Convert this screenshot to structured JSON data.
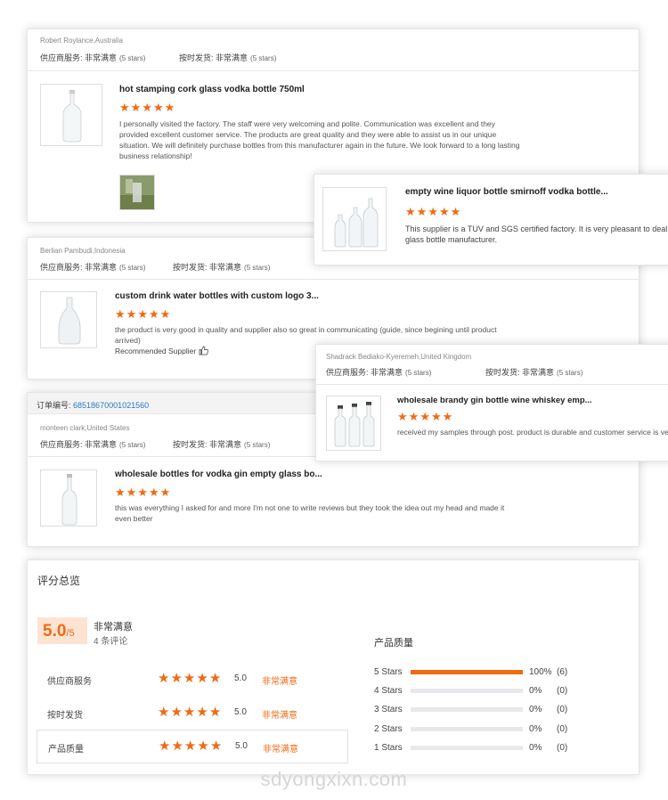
{
  "reviews": [
    {
      "reviewer": "Robert Roylance,Australia",
      "service_label": "供应商服务:",
      "service_value": "非常满意",
      "service_stars": "(5 stars)",
      "shipping_label": "按时发货:",
      "shipping_value": "非常满意",
      "shipping_stars": "(5 stars)",
      "product_title": "hot stamping cork glass vodka bottle 750ml",
      "rating": 5,
      "text": "I personally visited the factory.   The staff were very welcoming and polite.  Communication  was  excellent and they provided excellent customer service. The products are great quality and they were able to assist us in our unique situation. We will definitely purchase bottles from this manufacturer again in the future. We look forward to a long lasting business relationship!"
    },
    {
      "product_title": "empty wine liquor bottle smirnoff vodka bottle...",
      "rating": 5,
      "text": "This supplier is a TUV and SGS certified factory. It is very pleasant to deal glass bottle manufacturer."
    },
    {
      "reviewer": "Berlian Pambudi,Indonesia",
      "service_label": "供应商服务:",
      "service_value": "非常满意",
      "service_stars": "(5 stars)",
      "shipping_label": "按时发货:",
      "shipping_value": "非常满意",
      "shipping_stars": "(5 stars)",
      "product_title": "custom drink water bottles with custom logo 3...",
      "rating": 5,
      "text": "the product is very good in quality and supplier also so great in communicating (guide, since begining until product arrived)",
      "recommended": "Recommended Supplier"
    },
    {
      "reviewer": "Shadrack Bediako-Kyeremeh,United Kingdom",
      "service_label": "供应商服务:",
      "service_value": "非常满意",
      "service_stars": "(5 stars)",
      "shipping_label": "按时发货:",
      "shipping_value": "非常满意",
      "shipping_stars": "(5 stars)",
      "product_title": "wholesale brandy gin bottle wine whiskey emp...",
      "rating": 5,
      "text": "received my samples through post. product is durable and customer service is ve"
    },
    {
      "order_label": "订单编号:",
      "order_number": "68518670001021560",
      "reviewer": "monteen clark,United States",
      "service_label": "供应商服务:",
      "service_value": "非常满意",
      "service_stars": "(5 stars)",
      "shipping_label": "按时发货:",
      "shipping_value": "非常满意",
      "shipping_stars": "(5 stars)",
      "product_title": "wholesale bottles for vodka gin empty glass bo...",
      "rating": 5,
      "text": "this was everything I asked for and more I'm not one to write reviews but they took the idea out my head and made it even better"
    }
  ],
  "summary": {
    "title": "评分总览",
    "score": "5.0",
    "out_of": "/5",
    "satisfaction": "非常满意",
    "review_count": "4 条评论",
    "rows": [
      {
        "label": "供应商服务",
        "value": "5.0",
        "text": "非常满意"
      },
      {
        "label": "按时发货",
        "value": "5.0",
        "text": "非常满意"
      },
      {
        "label": "产品质量",
        "value": "5.0",
        "text": "非常满意"
      }
    ],
    "quality_title": "产品质量",
    "distribution": [
      {
        "label": "5 Stars",
        "fraction": 1.0,
        "pct": "100%",
        "count": "(6)"
      },
      {
        "label": "4 Stars",
        "fraction": 0,
        "pct": "0%",
        "count": "(0)"
      },
      {
        "label": "3 Stars",
        "fraction": 0,
        "pct": "0%",
        "count": "(0)"
      },
      {
        "label": "2 Stars",
        "fraction": 0,
        "pct": "0%",
        "count": "(0)"
      },
      {
        "label": "1 Stars",
        "fraction": 0,
        "pct": "0%",
        "count": "(0)"
      }
    ]
  },
  "watermark": "sdyongxixn.com",
  "colors": {
    "accent": "#f06a12",
    "link": "#2a78c8",
    "score_bg": "#fde3d2"
  }
}
